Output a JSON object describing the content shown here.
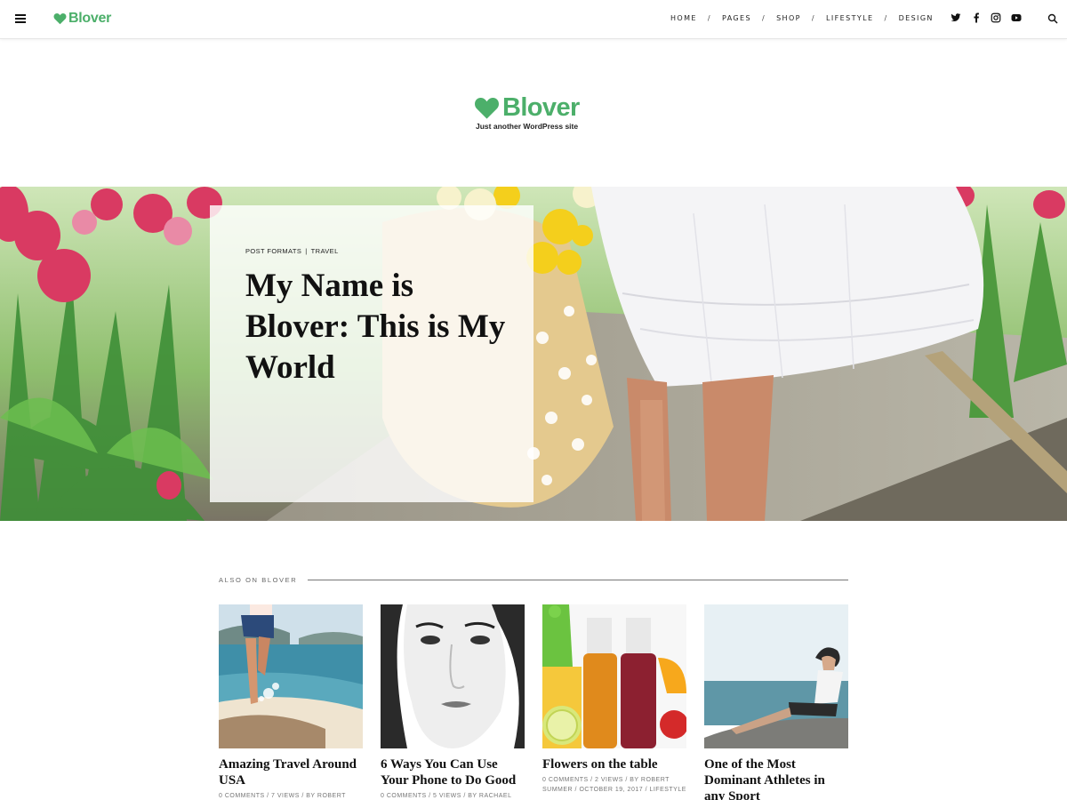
{
  "site": {
    "name": "Blover",
    "tagline": "Just another WordPress site",
    "accent": "#4caf6a"
  },
  "header": {
    "menu_icon": "hamburger-icon",
    "nav": [
      {
        "label": "HOME"
      },
      {
        "label": "PAGES"
      },
      {
        "label": "SHOP"
      },
      {
        "label": "LIFESTYLE"
      },
      {
        "label": "DESIGN"
      }
    ],
    "separator": "/",
    "social": [
      "twitter-icon",
      "facebook-icon",
      "instagram-icon",
      "youtube-icon"
    ],
    "search_icon": "search-icon"
  },
  "hero": {
    "categories": [
      "POST FORMATS",
      "TRAVEL"
    ],
    "category_separator": "|",
    "title": "My Name is Blover: This is My World"
  },
  "also_on": {
    "label": "ALSO ON BLOVER",
    "posts": [
      {
        "title": "Amazing Travel Around USA",
        "meta": "0 COMMENTS / 7 VIEWS / BY ROBERT"
      },
      {
        "title": "6 Ways You Can Use Your Phone to Do Good",
        "meta": "0 COMMENTS / 5 VIEWS / BY RACHAEL"
      },
      {
        "title": "Flowers on the table",
        "meta": "0 COMMENTS / 2 VIEWS / BY ROBERT SUMMER / OCTOBER 19, 2017 / LIFESTYLE"
      },
      {
        "title": "One of the Most Dominant Athletes in any Sport",
        "meta": ""
      }
    ]
  }
}
